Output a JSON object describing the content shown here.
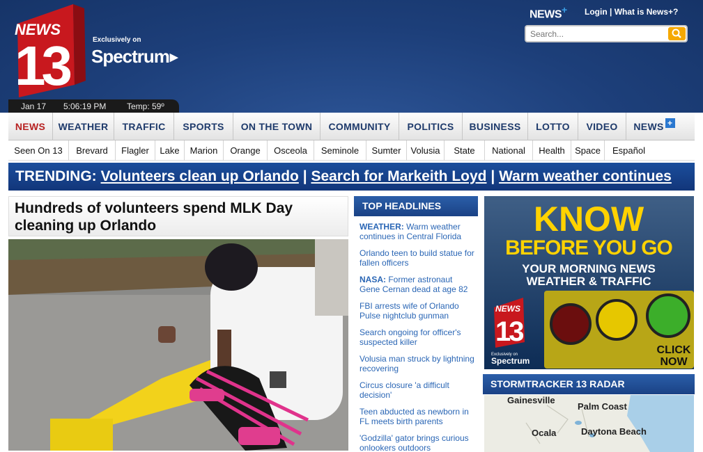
{
  "header": {
    "logo_news": "NEWS",
    "logo_13": "13",
    "exclusively_on": "Exclusively on",
    "spectrum": "Spectrum",
    "info": {
      "date": "Jan 17",
      "time": "5:06:19 PM",
      "temp": "Temp: 59º"
    },
    "news_plus": "NEWS",
    "login": "Login",
    "separator": "|",
    "what_is": "What is News+?",
    "search_placeholder": "Search..."
  },
  "nav_main": [
    {
      "label": "NEWS",
      "active": true
    },
    {
      "label": "WEATHER"
    },
    {
      "label": "TRAFFIC"
    },
    {
      "label": "SPORTS"
    },
    {
      "label": "ON THE TOWN"
    },
    {
      "label": "COMMUNITY"
    },
    {
      "label": "POLITICS"
    },
    {
      "label": "BUSINESS"
    },
    {
      "label": "LOTTO"
    },
    {
      "label": "VIDEO"
    },
    {
      "label": "NEWS"
    }
  ],
  "nav_sub": [
    "Seen On 13",
    "Brevard",
    "Flagler",
    "Lake",
    "Marion",
    "Orange",
    "Osceola",
    "Seminole",
    "Sumter",
    "Volusia",
    "State",
    "National",
    "Health",
    "Space",
    "Español"
  ],
  "trending": {
    "label": "TRENDING:",
    "items": [
      "Volunteers clean up Orlando",
      "Search for Markeith Loyd",
      "Warm weather continues"
    ],
    "sep": "|"
  },
  "story": {
    "headline": "Hundreds of volunteers spend MLK Day cleaning up Orlando"
  },
  "top_headlines": {
    "title": "TOP HEADLINES",
    "items": [
      {
        "kw": "WEATHER:",
        "text": " Warm weather continues in Central Florida"
      },
      {
        "kw": "",
        "text": "Orlando teen to build statue for fallen officers"
      },
      {
        "kw": "NASA:",
        "text": " Former astronaut Gene Cernan dead at age 82"
      },
      {
        "kw": "",
        "text": "FBI arrests wife of Orlando Pulse nightclub gunman"
      },
      {
        "kw": "",
        "text": "Search ongoing for officer's suspected killer"
      },
      {
        "kw": "",
        "text": "Volusia man struck by lightning recovering"
      },
      {
        "kw": "",
        "text": "Circus closure 'a difficult decision'"
      },
      {
        "kw": "",
        "text": "Teen abducted as newborn in FL meets birth parents"
      },
      {
        "kw": "",
        "text": "'Godzilla' gator brings curious onlookers outdoors"
      }
    ]
  },
  "ad": {
    "line1": "KNOW",
    "line2": "BEFORE YOU GO",
    "line3": "YOUR MORNING NEWS",
    "line4": "WEATHER & TRAFFIC",
    "logo_news": "NEWS",
    "logo_13": "13",
    "exclusively": "Exclusively on",
    "spectrum": "Spectrum",
    "click1": "CLICK",
    "click2": "NOW"
  },
  "radar": {
    "title": "STORMTRACKER 13 RADAR",
    "cities": [
      "Gainesville",
      "Palm Coast",
      "Ocala",
      "Daytona Beach"
    ]
  },
  "colors": {
    "brand_blue": "#1d3f7a",
    "accent_orange": "#f5a800",
    "active_red": "#b72121",
    "ad_yellow": "#ffd200"
  }
}
